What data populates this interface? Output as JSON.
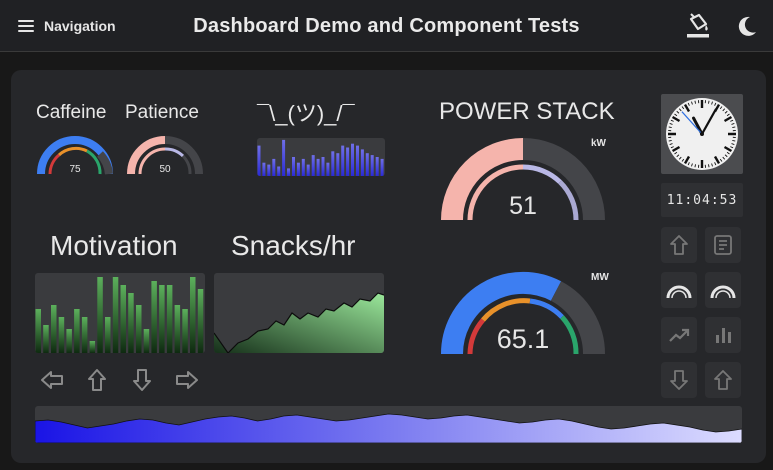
{
  "header": {
    "nav_label": "Navigation",
    "title": "Dashboard Demo and Component Tests",
    "icons": [
      "menu-icon",
      "paint-bucket-icon",
      "dark-mode-icon"
    ]
  },
  "gauges_small": [
    {
      "title": "Caffeine",
      "value": "75",
      "fraction": 0.75
    },
    {
      "title": "Patience",
      "value": "50",
      "fraction": 0.5
    }
  ],
  "shrug": {
    "title": "¯\\_(ツ)_/¯"
  },
  "power": {
    "title": "POWER STACK",
    "kw": {
      "unit": "kW",
      "value": "51",
      "fraction": 0.51
    },
    "mw": {
      "unit": "MW",
      "value": "65.1",
      "fraction": 0.651
    }
  },
  "motivation": {
    "title": "Motivation"
  },
  "snacks": {
    "title": "Snacks/hr"
  },
  "clock": {
    "digital": "11:04:53",
    "hour": 11,
    "minute": 4,
    "second": 53
  },
  "arrows": [
    "arrow-left-icon",
    "arrow-up-icon",
    "arrow-down-icon",
    "arrow-right-icon"
  ],
  "side_buttons": [
    "arrow-up-icon",
    "document-icon",
    "gauge-icon",
    "gauge-icon",
    "trending-up-icon",
    "bar-chart-icon",
    "arrow-down-icon",
    "arrow-up-icon"
  ],
  "colors": {
    "blue": "#3d7ef2",
    "orange": "#e8912a",
    "green": "#2aa56b",
    "red": "#d33a3a",
    "pink": "#f5b4ac",
    "lavender": "#b9b8e6",
    "purple_dark": "#2020c8"
  }
}
